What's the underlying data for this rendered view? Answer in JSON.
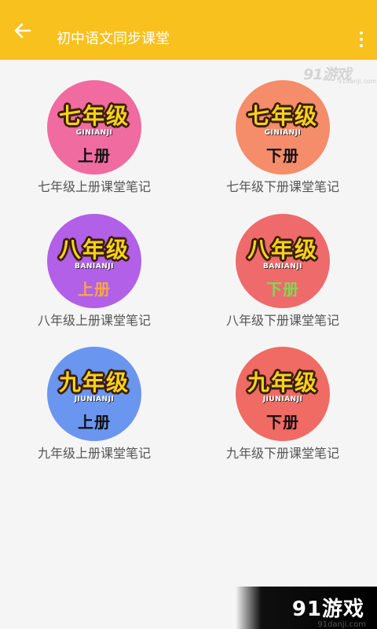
{
  "app_bar": {
    "title": "初中语文同步课堂",
    "back_icon": "arrow-left-icon",
    "menu_icon": "more-vertical-icon",
    "color": "#f9c11d"
  },
  "watermark_top": {
    "brand": "91游戏",
    "url": "91danji.com"
  },
  "cards": [
    {
      "grade": "七年级",
      "pinyin": "GINIANJI",
      "volume": "上册",
      "caption": "七年级上册课堂笔记",
      "bg": "#f06ba0",
      "vol_color": "#111111"
    },
    {
      "grade": "七年级",
      "pinyin": "GINIANJI",
      "volume": "下册",
      "caption": "七年级下册课堂笔记",
      "bg": "#f58c6a",
      "vol_color": "#111111"
    },
    {
      "grade": "八年级",
      "pinyin": "BANIANJI",
      "volume": "上册",
      "caption": "八年级上册课堂笔记",
      "bg": "#b260e8",
      "vol_color": "#f7a54a"
    },
    {
      "grade": "八年级",
      "pinyin": "BANIANJI",
      "volume": "下册",
      "caption": "八年级下册课堂笔记",
      "bg": "#ef6a6a",
      "vol_color": "#7ed957"
    },
    {
      "grade": "九年级",
      "pinyin": "JIUNIANJI",
      "volume": "上册",
      "caption": "九年级上册课堂笔记",
      "bg": "#6a96f0",
      "vol_color": "#111111"
    },
    {
      "grade": "九年级",
      "pinyin": "JIUNIANJI",
      "volume": "下册",
      "caption": "九年级下册课堂笔记",
      "bg": "#f06b64",
      "vol_color": "#111111"
    }
  ],
  "watermark_bottom": {
    "brand": "91游戏",
    "url": "91danji.com"
  }
}
